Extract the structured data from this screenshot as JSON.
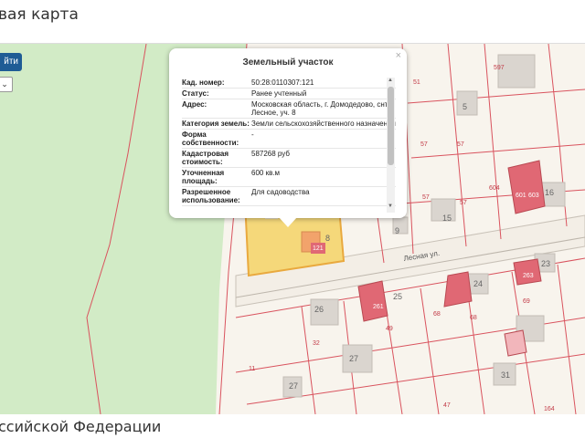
{
  "header": {
    "title": "вая карта"
  },
  "controls": {
    "find_label": "йти",
    "select_value": "⌄"
  },
  "popup": {
    "title": "Земельный участок",
    "close": "×",
    "rows": [
      {
        "key": "Кад. номер:",
        "value": "50:28:0110307:121"
      },
      {
        "key": "Статус:",
        "value": "Ранее учтенный"
      },
      {
        "key": "Адрес:",
        "value": "Московская область, г. Домодедово, снт Лесное, уч. 8"
      },
      {
        "key": "Категория земель:",
        "value": "Земли сельскохозяйственного назначения"
      },
      {
        "key": "Форма собственности:",
        "value": "-"
      },
      {
        "key": "Кадастровая стоимость:",
        "value": "587268 руб"
      },
      {
        "key": "Уточненная площадь:",
        "value": "600 кв.м"
      },
      {
        "key": "Разрешенное использование:",
        "value": "Для садоводства"
      }
    ]
  },
  "map": {
    "street_label": "Лесная ул.",
    "labels": [
      "597",
      "51",
      "5",
      "57",
      "57",
      "604",
      "601",
      "603",
      "16",
      "57",
      "57",
      "15",
      "9",
      "8",
      "121",
      "24",
      "23",
      "25",
      "26",
      "27",
      "27",
      "261",
      "263",
      "69",
      "68",
      "68",
      "49",
      "32",
      "11",
      "27",
      "31",
      "164",
      "47"
    ],
    "colors": {
      "forest": "#cfe8c2",
      "parcel_border": "#e0666e",
      "selected_fill": "#f5d87a",
      "built_red": "#e06874",
      "building_gray": "#d8d4cf"
    }
  },
  "footer": {
    "title": "ссийской Федерации"
  }
}
